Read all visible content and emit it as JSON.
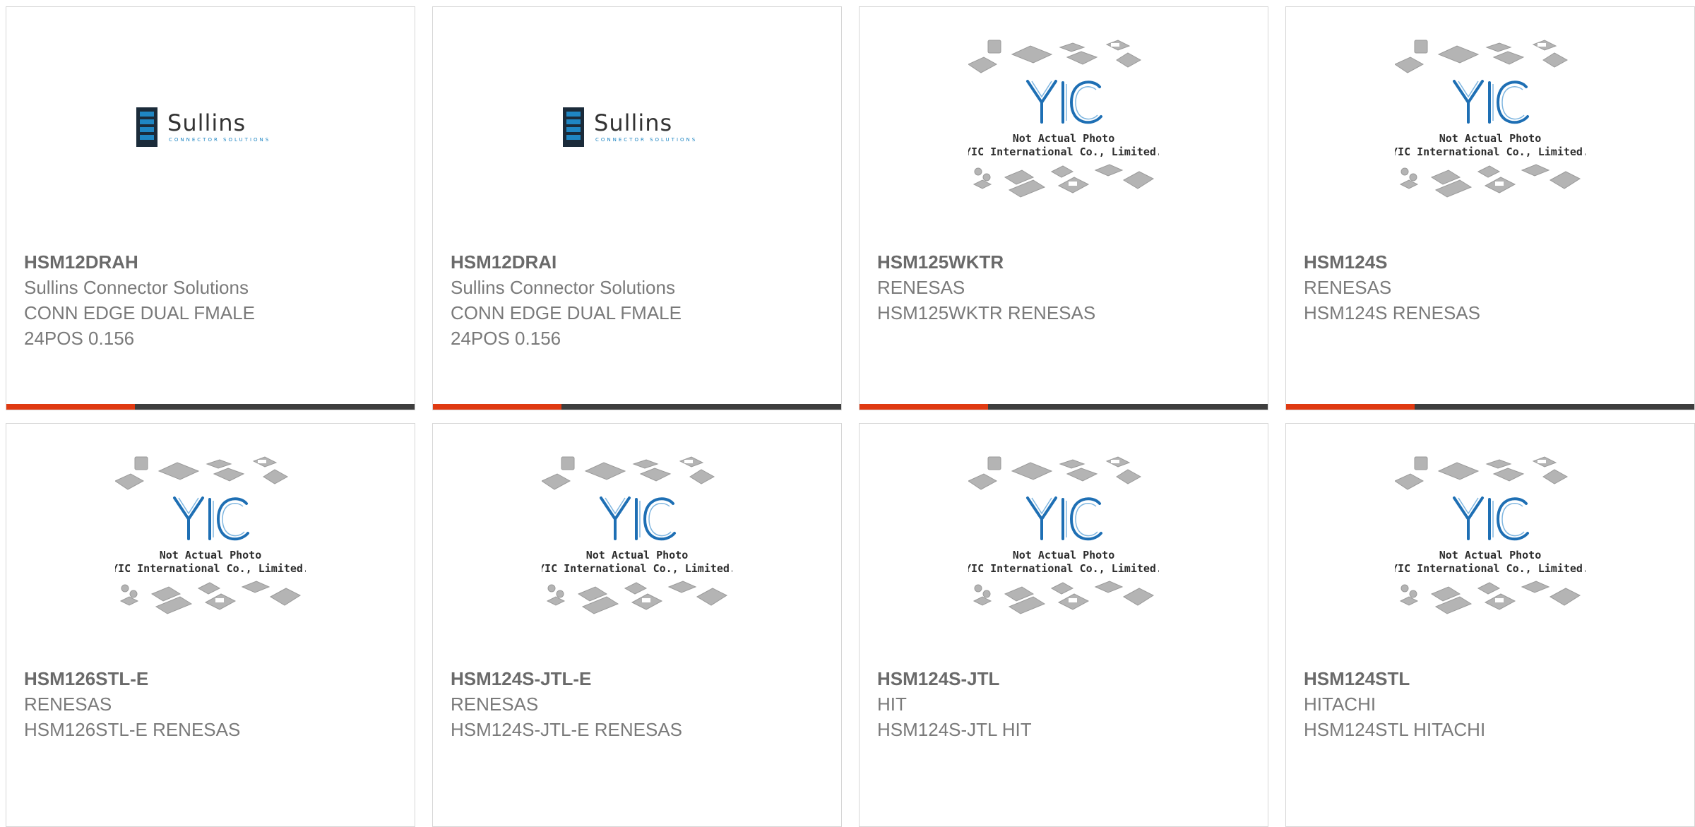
{
  "colors": {
    "accent_bar": "#e03a12",
    "dark_bar": "#3e3e3e",
    "text_bold": "#6a6a6a",
    "text_regular": "#7a7a7a",
    "sullins_blue": "#1f86c3",
    "yic_blue": "#1e6fb4"
  },
  "sullins_logo": {
    "icon": "sullins-logo-icon",
    "wordmark": "Sullins",
    "tagline": "CONNECTOR SOLUTIONS"
  },
  "yic_placeholder": {
    "icon": "yic-logo-icon",
    "line1": "Not Actual Photo",
    "line2": "YIC International Co., Limited."
  },
  "products": [
    {
      "image": "sullins",
      "part_number": "HSM12DRAH",
      "manufacturer": "Sullins Connector Solutions",
      "desc1": "CONN EDGE DUAL FMALE",
      "desc2": "24POS 0.156"
    },
    {
      "image": "sullins",
      "part_number": "HSM12DRAI",
      "manufacturer": "Sullins Connector Solutions",
      "desc1": "CONN EDGE DUAL FMALE",
      "desc2": "24POS 0.156"
    },
    {
      "image": "yic",
      "part_number": "HSM125WKTR",
      "manufacturer": "RENESAS",
      "desc1": "HSM125WKTR RENESAS",
      "desc2": ""
    },
    {
      "image": "yic",
      "part_number": "HSM124S",
      "manufacturer": "RENESAS",
      "desc1": "HSM124S RENESAS",
      "desc2": ""
    },
    {
      "image": "yic",
      "part_number": "HSM126STL-E",
      "manufacturer": "RENESAS",
      "desc1": "HSM126STL-E RENESAS",
      "desc2": ""
    },
    {
      "image": "yic",
      "part_number": "HSM124S-JTL-E",
      "manufacturer": "RENESAS",
      "desc1": "HSM124S-JTL-E RENESAS",
      "desc2": ""
    },
    {
      "image": "yic",
      "part_number": "HSM124S-JTL",
      "manufacturer": "HIT",
      "desc1": "HSM124S-JTL HIT",
      "desc2": ""
    },
    {
      "image": "yic",
      "part_number": "HSM124STL",
      "manufacturer": "HITACHI",
      "desc1": "HSM124STL HITACHI",
      "desc2": ""
    }
  ]
}
